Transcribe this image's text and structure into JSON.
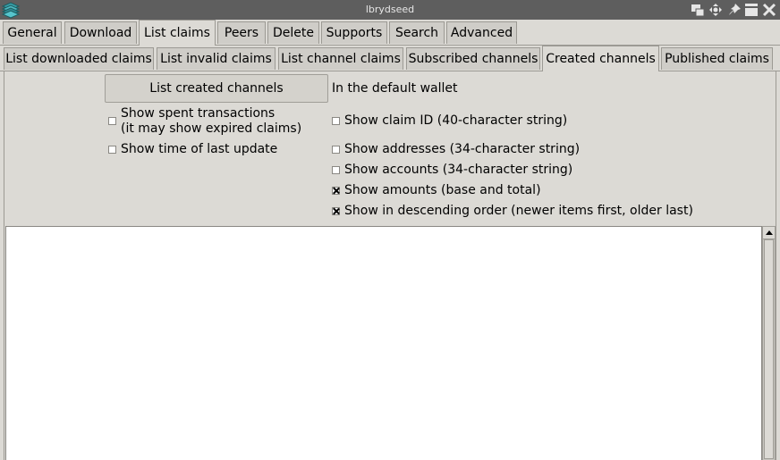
{
  "window": {
    "title": "lbrydseed",
    "app_icon": "books-icon"
  },
  "main_tabs": [
    {
      "label": "General"
    },
    {
      "label": "Download"
    },
    {
      "label": "List claims"
    },
    {
      "label": "Peers"
    },
    {
      "label": "Delete"
    },
    {
      "label": "Supports"
    },
    {
      "label": "Search"
    },
    {
      "label": "Advanced"
    }
  ],
  "main_tabs_active": "List claims",
  "sub_tabs": [
    {
      "label": "List downloaded claims"
    },
    {
      "label": "List invalid claims"
    },
    {
      "label": "List channel claims"
    },
    {
      "label": "Subscribed channels"
    },
    {
      "label": "Created channels"
    },
    {
      "label": "Published claims"
    }
  ],
  "sub_tabs_active": "Created channels",
  "controls": {
    "list_button": "List created channels",
    "wallet_label": "In the default wallet",
    "show_spent_line1": "Show spent transactions",
    "show_spent_line2": "(it may show expired claims)",
    "show_time": "Show time of last update",
    "show_claim_id": "Show claim ID (40-character string)",
    "show_addresses": "Show addresses (34-character string)",
    "show_accounts": "Show accounts (34-character string)",
    "show_amounts": "Show amounts (base and total)",
    "show_descending": "Show in descending order (newer items first, older last)"
  },
  "checkbox_states": {
    "show_spent": false,
    "show_time": false,
    "show_claim_id": false,
    "show_addresses": false,
    "show_accounts": false,
    "show_amounts": true,
    "show_descending": true
  },
  "output_text": ""
}
